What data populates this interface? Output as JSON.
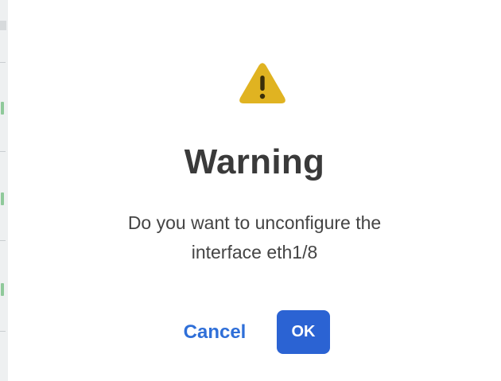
{
  "dialog": {
    "icon": "warning-triangle-icon",
    "title": "Warning",
    "message_line1": "Do you want to unconfigure the",
    "message_line2": "interface eth1/8",
    "cancel_label": "Cancel",
    "ok_label": "OK"
  },
  "colors": {
    "warning_icon": "#E0B321",
    "title_text": "#3A3A3A",
    "link_blue": "#2F6FD8",
    "primary_button": "#2B63D3"
  }
}
